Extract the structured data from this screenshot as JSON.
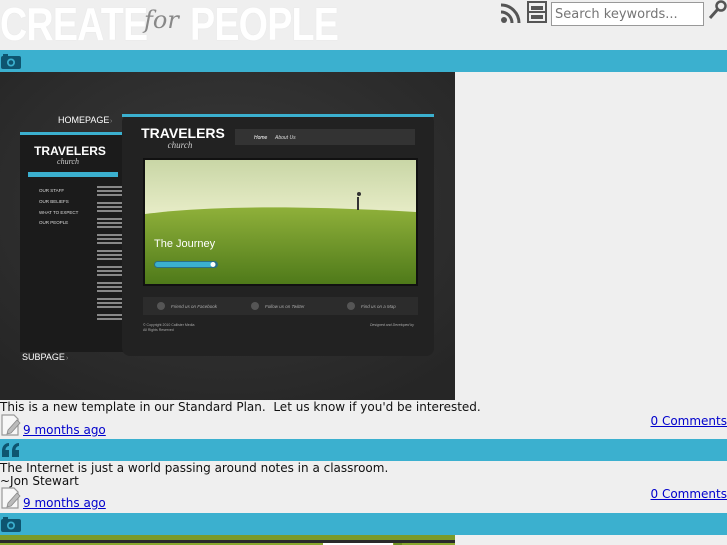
{
  "header": {
    "logo_word1": "CREATE",
    "logo_word2": "for",
    "logo_word3": "PEOPLE",
    "search_placeholder": "Search keywords..."
  },
  "hero": {
    "nav_homepage": "HOMEPAGE",
    "nav_subpage": "SUBPAGE",
    "brand_title": "TRAVELERS",
    "brand_sub": "church",
    "menu_home": "Home",
    "menu_about": "About Us",
    "journey": "The Journey",
    "sidebar_items": [
      "OUR STAFF",
      "OUR BELIEFS",
      "WHAT TO EXPECT",
      "OUR PEOPLE"
    ],
    "social": [
      "Friend us on Facebook",
      "Follow us on Twitter",
      "Find us on a Map"
    ],
    "copyright": "© Copyright 2010 Callister Media",
    "rights": "All Rights Reserved",
    "designed": "Designed and Developed by"
  },
  "posts": [
    {
      "text": "This is a new template in our Standard Plan.  Let us know if you'd be interested.",
      "time": "9 months ago",
      "comments": "0 Comments"
    },
    {
      "text": "The Internet is just a world passing around notes in a classroom.",
      "author": "~Jon Stewart",
      "time": "9 months ago",
      "comments": "0 Comments"
    }
  ],
  "colors": {
    "accent_bar": "#3bb0cf",
    "icon": "#0e5570",
    "link": "#0000cc"
  }
}
